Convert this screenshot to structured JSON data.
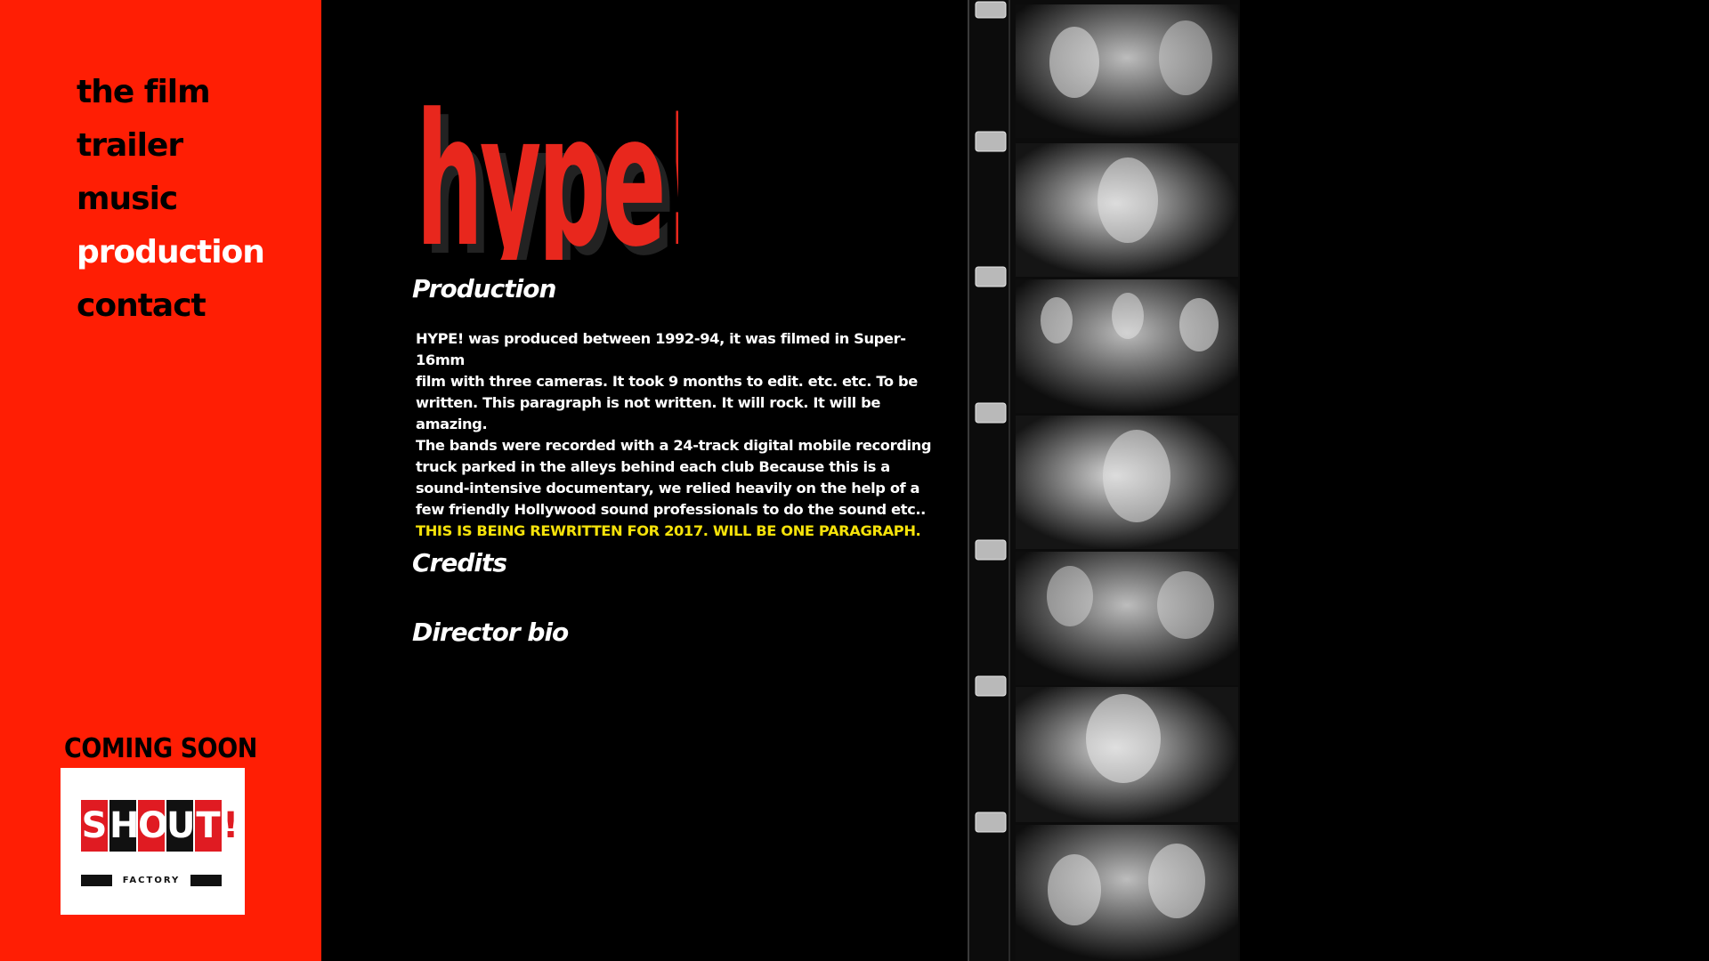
{
  "nav": {
    "items": [
      {
        "label": "the film",
        "active": false
      },
      {
        "label": "trailer",
        "active": false
      },
      {
        "label": "music",
        "active": false
      },
      {
        "label": "production",
        "active": true
      },
      {
        "label": "contact",
        "active": false
      }
    ]
  },
  "promo": {
    "coming_soon": "COMING SOON",
    "logo_letters": [
      "S",
      "H",
      "O",
      "U",
      "T",
      "!"
    ],
    "logo_subtext": "FACTORY"
  },
  "logo": {
    "text": "hype!"
  },
  "main": {
    "production_heading": "Production",
    "paragraph_lines": [
      "HYPE! was produced between 1992-94, it was filmed in Super-16mm",
      "film with three cameras. It took 9 months to edit.  etc. etc. To be",
      "written. This paragraph is not written.  It will rock. It will be amazing.",
      "The bands were recorded with a 24-track digital mobile recording",
      "truck parked in the alleys behind each club Because this is a",
      "sound-intensive documentary, we relied heavily on the help of a",
      "few friendly Hollywood sound professionals to do the sound etc.."
    ],
    "paragraph_note": "THIS IS BEING REWRITTEN FOR 2017. WILL BE ONE PARAGRAPH.",
    "credits_heading": "Credits",
    "director_heading": "Director bio"
  },
  "colors": {
    "sidebar_red": "#ff1e04",
    "logo_red": "#e8271d",
    "note_yellow": "#f5e20a",
    "background": "#000000"
  }
}
